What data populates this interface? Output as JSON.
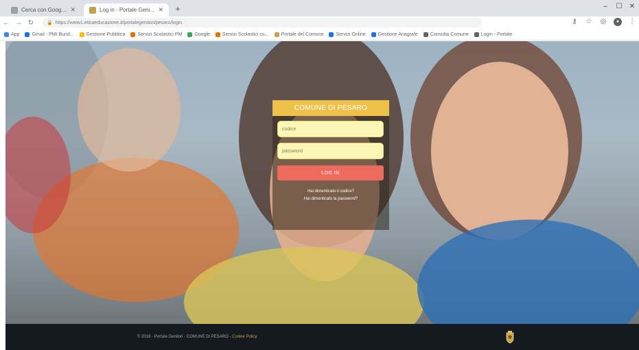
{
  "browser": {
    "tabs": [
      {
        "title": "Cerca con Google Chrome"
      },
      {
        "title": "Log in - Portale Genitori"
      }
    ],
    "url": "https://www1.eticaeducazione.it/portalegenitori/pesaro/login",
    "bookmarks": [
      {
        "label": "App",
        "color": "#4285f4"
      },
      {
        "label": "Gmail - PMI Bund...",
        "color": "#1a73e8"
      },
      {
        "label": "Gestione Pubblica",
        "color": "#fbbc04"
      },
      {
        "label": "Servizi Scolastici PM",
        "color": "#e37400"
      },
      {
        "label": "Google",
        "color": "#34a853"
      },
      {
        "label": "Servizi Scolastici co...",
        "color": "#e37400"
      },
      {
        "label": "Portale del Comune",
        "color": "#c5a24a"
      },
      {
        "label": "Servizi Online",
        "color": "#1a73e8"
      },
      {
        "label": "Gestione Anagrafe",
        "color": "#1a73e8"
      },
      {
        "label": "Consulta Comune",
        "color": "#5f6368"
      },
      {
        "label": "Login - Portale",
        "color": "#5f6368"
      }
    ]
  },
  "login": {
    "title": "COMUNE DI PESARO",
    "username_placeholder": "codice",
    "password_placeholder": "password",
    "button": "LOG IN",
    "forgot_username": "Hai dimenticato il codice?",
    "forgot_password": "Hai dimenticato la password?"
  },
  "footer": {
    "copyright": "© 2018 - Portale Genitori - COMUNE DI PESARO - ",
    "cookie": "Cookie Policy"
  }
}
